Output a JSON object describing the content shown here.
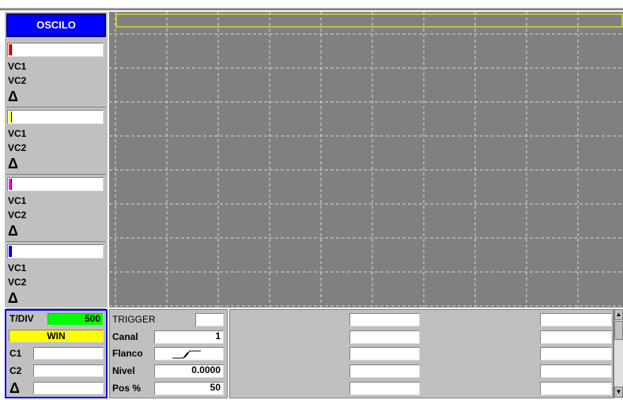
{
  "header": {
    "title": "OSCILO"
  },
  "channels": [
    {
      "color": "#ff0000",
      "vc1": "VC1",
      "vc2": "VC2",
      "delta": "Δ"
    },
    {
      "color": "#ffff00",
      "vc1": "VC1",
      "vc2": "VC2",
      "delta": "Δ"
    },
    {
      "color": "#ff00ff",
      "vc1": "VC1",
      "vc2": "VC2",
      "delta": "Δ"
    },
    {
      "color": "#0000ff",
      "vc1": "VC1",
      "vc2": "VC2",
      "delta": "Δ"
    }
  ],
  "timebase": {
    "label": "T/DIV",
    "value": "500",
    "mode": "WIN",
    "c1": "C1",
    "c2": "C2",
    "delta": "Δ"
  },
  "trigger": {
    "title": "TRIGGER",
    "canal_label": "Canal",
    "canal_value": "1",
    "flanco_label": "Flanco",
    "nivel_label": "Nivel",
    "nivel_value": "0.0000",
    "pos_label": "Pos %",
    "pos_value": "50"
  },
  "colors": {
    "accent_blue": "#0000ff",
    "trigger_line": "#ffff00",
    "timebase_green": "#00ff00",
    "win_yellow": "#ffff00"
  }
}
